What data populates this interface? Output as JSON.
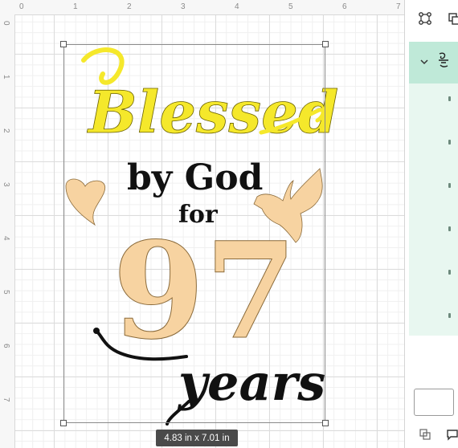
{
  "ruler": {
    "top_numbers": [
      "0",
      "1",
      "2",
      "3",
      "4",
      "5",
      "6",
      "7"
    ],
    "left_numbers": [
      "0",
      "1",
      "2",
      "3",
      "4",
      "5",
      "6",
      "7"
    ]
  },
  "artwork": {
    "word_blessed": "Blessed",
    "line_by_god": "by God",
    "word_for": "for",
    "number": "97",
    "word_years": "years",
    "colors": {
      "yellow": "#f5e82b",
      "tan": "#f7d3a1",
      "black": "#111111"
    }
  },
  "selection": {
    "size_text": "4.83  in x 7.01  in"
  },
  "right_panel": {
    "icons": [
      "group-icon",
      "duplicate-icon",
      "chevron-down-icon",
      "layer-thumbnail-icon"
    ],
    "accent_color": "#bfe9d8"
  }
}
